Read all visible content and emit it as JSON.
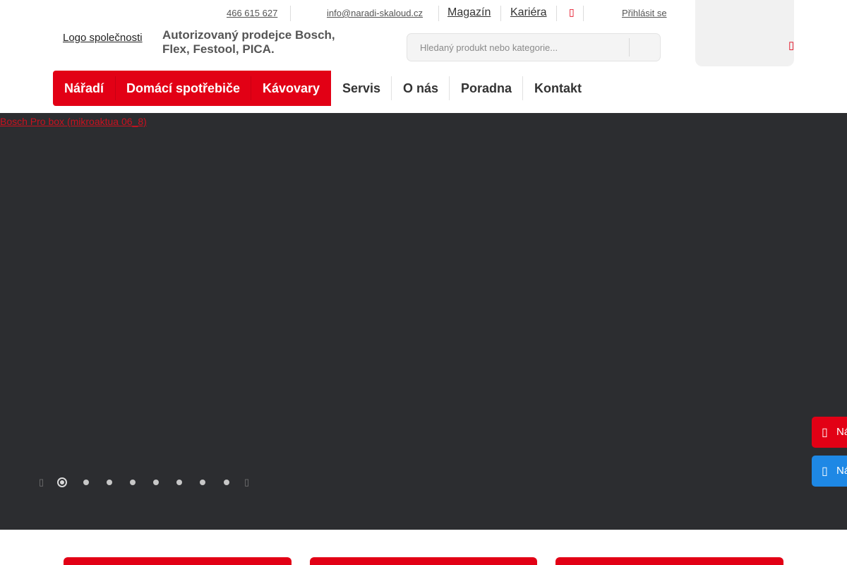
{
  "topbar": {
    "phone": "466 615 627",
    "email": "info@naradi-skaloud.cz",
    "magazine": "Magazín",
    "careers": "Kariéra",
    "login": "Přihlásit se"
  },
  "header": {
    "logo_alt": "Logo společnosti",
    "tagline": "Autorizovaný prodejce Bosch, Flex, Festool, PICA."
  },
  "search": {
    "placeholder": "Hledaný produkt nebo kategorie..."
  },
  "nav": {
    "items": [
      {
        "label": "Nářadí"
      },
      {
        "label": "Domácí spotřebiče"
      },
      {
        "label": "Kávovary"
      },
      {
        "label": "Servis"
      },
      {
        "label": "O nás"
      },
      {
        "label": "Poradna"
      },
      {
        "label": "Kontakt"
      }
    ]
  },
  "slider": {
    "image_alt": "Bosch Pro box (mikroaktua 06_8)",
    "slide_count": 8,
    "active_slide": 1
  },
  "side_buttons": {
    "first_label": "Ná",
    "second_label": "Ná"
  },
  "colors": {
    "brand_red": "#e20015",
    "slider_bg": "#2c2d30",
    "side_blue": "#1e88e5"
  },
  "icons": {
    "search": "search-icon",
    "cart": "cart-icon",
    "top_red": "heart-icon",
    "slider_prev": "chevron-left-icon",
    "slider_next": "chevron-right-icon",
    "side_first": "phone-icon",
    "side_second": "chat-icon"
  }
}
